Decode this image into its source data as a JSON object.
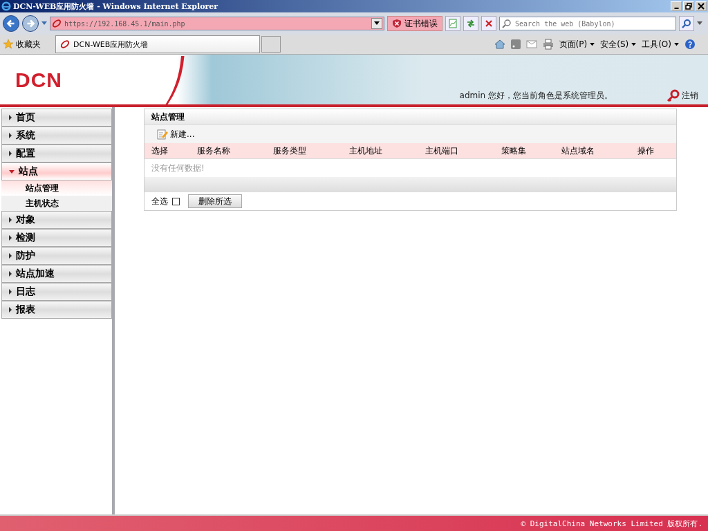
{
  "window": {
    "title": "DCN-WEB应用防火墙 - Windows Internet Explorer"
  },
  "address_bar": {
    "url": "https://192.168.45.1/main.php",
    "cert_error": "证书错误"
  },
  "search": {
    "placeholder": "Search the web (Babylon)"
  },
  "favorites_bar": {
    "label": "收藏夹",
    "tab_title": "DCN-WEB应用防火墙"
  },
  "command_bar": [
    "页面(P)",
    "安全(S)",
    "工具(O)"
  ],
  "header": {
    "logo": "DCN",
    "greeting": "admin 您好，您当前角色是系统管理员。",
    "logout": "注销"
  },
  "sidebar": {
    "items": [
      {
        "label": "首页",
        "expanded": false
      },
      {
        "label": "系统",
        "expanded": false
      },
      {
        "label": "配置",
        "expanded": false
      },
      {
        "label": "站点",
        "expanded": true,
        "children": [
          {
            "label": "站点管理",
            "selected": true
          },
          {
            "label": "主机状态",
            "selected": false
          }
        ]
      },
      {
        "label": "对象",
        "expanded": false
      },
      {
        "label": "检测",
        "expanded": false
      },
      {
        "label": "防护",
        "expanded": false
      },
      {
        "label": "站点加速",
        "expanded": false
      },
      {
        "label": "日志",
        "expanded": false
      },
      {
        "label": "报表",
        "expanded": false
      }
    ]
  },
  "panel": {
    "title": "站点管理",
    "new_button": "新建...",
    "columns": [
      "选择",
      "服务名称",
      "服务类型",
      "主机地址",
      "主机端口",
      "策略集",
      "站点域名",
      "操作"
    ],
    "empty_message": "没有任何数据!",
    "select_all": {
      "label": "全选",
      "checked": false
    },
    "delete_button": "删除所选"
  },
  "footer": {
    "copyright": "© DigitalChina Networks Limited 版权所有."
  }
}
